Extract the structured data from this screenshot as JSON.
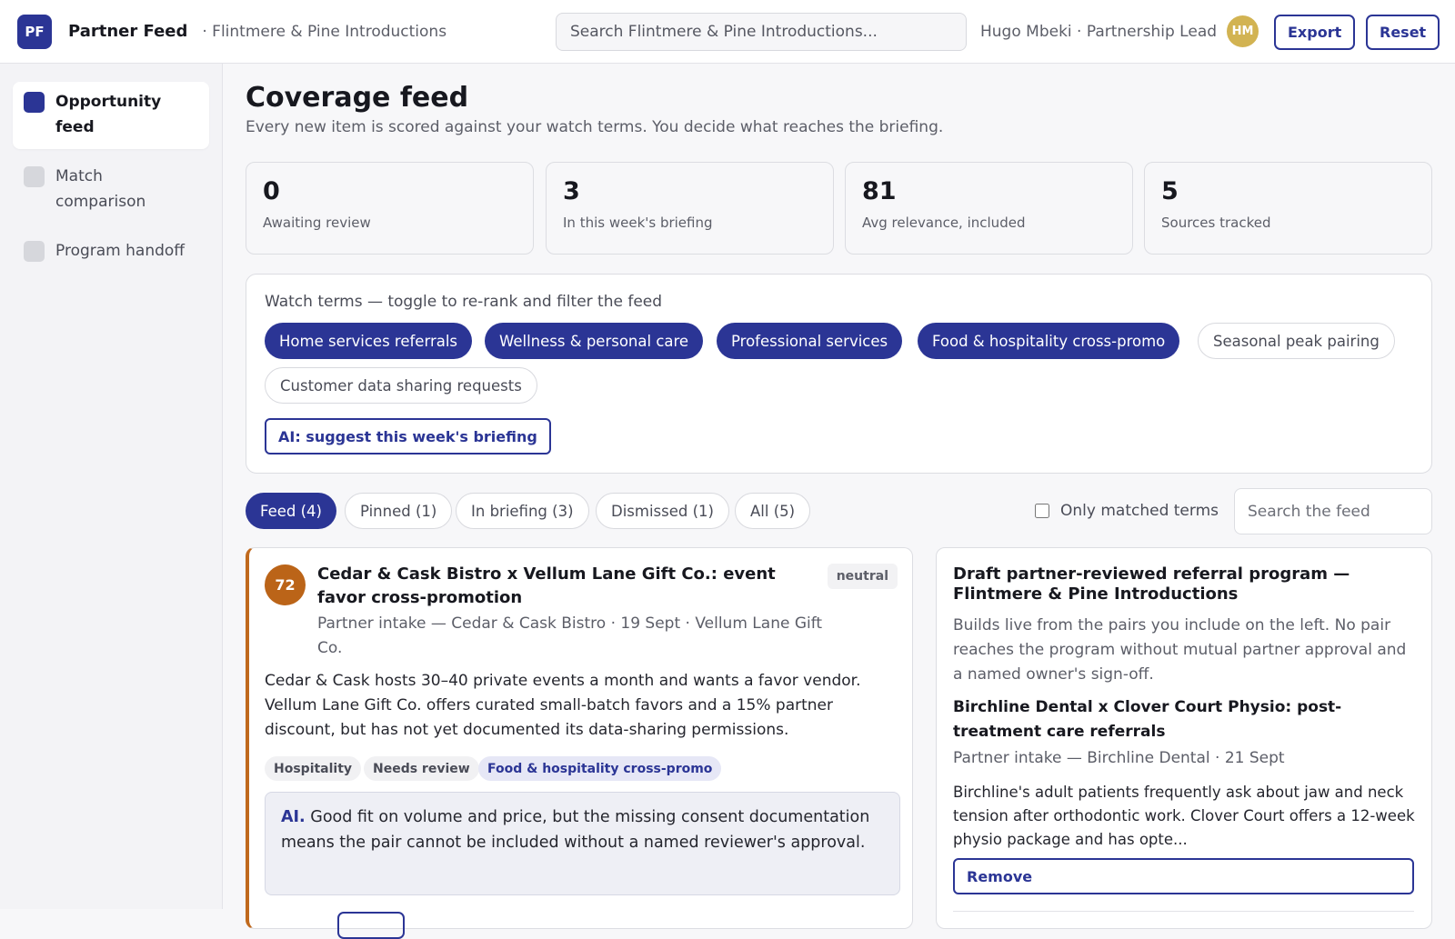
{
  "header": {
    "logo_text": "PF",
    "app_title": "Partner Feed",
    "org": "· Flintmere & Pine Introductions",
    "search_placeholder": "Search Flintmere & Pine Introductions...",
    "user": "Hugo Mbeki · Partnership Lead",
    "avatar": "HM",
    "export_label": "Export",
    "reset_label": "Reset"
  },
  "sidebar": {
    "items": [
      {
        "label": "Opportunity feed",
        "active": true
      },
      {
        "label": "Match comparison",
        "active": false
      },
      {
        "label": "Program handoff",
        "active": false
      }
    ]
  },
  "page": {
    "title": "Coverage feed",
    "subtitle": "Every new item is scored against your watch terms. You decide what reaches the briefing."
  },
  "stats": [
    {
      "value": "0",
      "label": "Awaiting review"
    },
    {
      "value": "3",
      "label": "In this week's briefing"
    },
    {
      "value": "81",
      "label": "Avg relevance, included"
    },
    {
      "value": "5",
      "label": "Sources tracked"
    }
  ],
  "watch_terms": {
    "title": "Watch terms — toggle to re-rank and filter the feed",
    "terms": [
      {
        "label": "Home services referrals",
        "on": true
      },
      {
        "label": "Wellness & personal care",
        "on": true
      },
      {
        "label": "Professional services",
        "on": true
      },
      {
        "label": "Food & hospitality cross-promo",
        "on": true
      },
      {
        "label": "Seasonal peak pairing",
        "on": false
      },
      {
        "label": "Customer data sharing requests",
        "on": false
      }
    ],
    "ai_button": "AI: suggest this week's briefing"
  },
  "tabs": [
    {
      "label": "Feed (4)",
      "active": true
    },
    {
      "label": "Pinned (1)",
      "active": false
    },
    {
      "label": "In briefing (3)",
      "active": false
    },
    {
      "label": "Dismissed (1)",
      "active": false
    },
    {
      "label": "All (5)",
      "active": false
    }
  ],
  "filters": {
    "only_matched_label": "Only matched terms",
    "only_matched_checked": false,
    "feed_search_placeholder": "Search the feed"
  },
  "feed_item": {
    "score": "72",
    "title": "Cedar & Cask Bistro x Vellum Lane Gift Co.: event favor cross-promotion",
    "sentiment": "neutral",
    "meta": "Partner intake — Cedar & Cask Bistro · 19 Sept · Vellum Lane Gift Co.",
    "body": "Cedar & Cask hosts 30–40 private events a month and wants a favor vendor. Vellum Lane Gift Co. offers curated small-batch favors and a 15% partner discount, but has not yet documented its data-sharing permissions.",
    "tags": [
      {
        "label": "Hospitality",
        "term": false
      },
      {
        "label": "Needs review",
        "term": false
      },
      {
        "label": "Food & hospitality cross-promo",
        "term": true
      }
    ],
    "ai_prefix": "AI.",
    "ai_text": " Good fit on volume and price, but the missing consent documentation means the pair cannot be included without a named reviewer's approval."
  },
  "draft": {
    "title": "Draft partner-reviewed referral program — Flintmere & Pine Introductions",
    "description": "Builds live from the pairs you include on the left. No pair reaches the program without mutual partner approval and a named owner's sign-off.",
    "pair": {
      "title": "Birchline Dental x Clover Court Physio: post-treatment care referrals",
      "meta": "Partner intake — Birchline Dental · 21 Sept",
      "body": "Birchline's adult patients frequently ask about jaw and neck tension after orthodontic work. Clover Court offers a 12-week physio package and has opte...",
      "remove_label": "Remove"
    }
  },
  "colors": {
    "accent": "#2b3595",
    "score_badge": "#bb6418",
    "avatar": "#d2b352"
  }
}
